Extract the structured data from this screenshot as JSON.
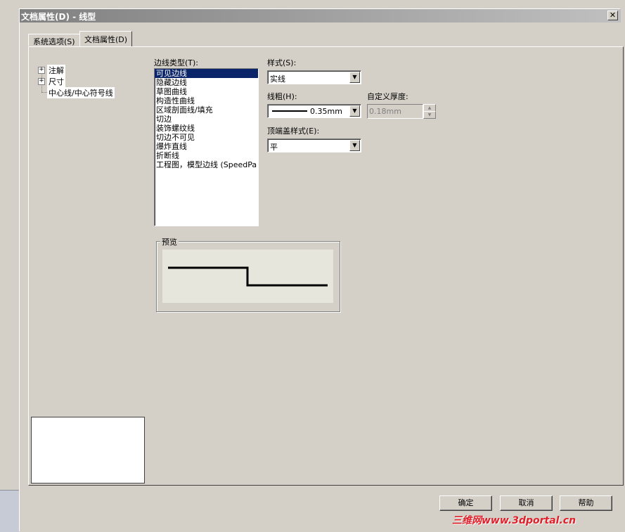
{
  "window": {
    "title": "文档属性(D) - 线型",
    "close_glyph": "✕"
  },
  "tabs": [
    {
      "label": "系统选项(S)",
      "active": false
    },
    {
      "label": "文档属性(D)",
      "active": true
    }
  ],
  "tree": {
    "items": [
      {
        "label": "注解",
        "expandable": true
      },
      {
        "label": "尺寸",
        "expandable": true
      },
      {
        "label": "中心线/中心符号线",
        "expandable": false
      }
    ]
  },
  "edge_type": {
    "label": "边线类型(T):",
    "items": [
      "可见边线",
      "隐藏边线",
      "草图曲线",
      "构造性曲线",
      "区域剖面线/填充",
      "切边",
      "装饰螺纹线",
      "切边不可见",
      "爆炸直线",
      "折断线",
      "工程图，模型边线 (SpeedPa"
    ],
    "selected_index": 0
  },
  "style": {
    "label": "样式(S):",
    "value": "实线"
  },
  "thickness": {
    "label": "线粗(H):",
    "value": "0.35mm"
  },
  "custom_thickness": {
    "label": "自定义厚度:",
    "value": "0.18mm"
  },
  "end_cap": {
    "label": "顶端盖样式(E):",
    "value": "平"
  },
  "preview": {
    "label": "预览"
  },
  "buttons": {
    "ok": "确定",
    "cancel": "取消",
    "help": "帮助"
  },
  "watermark": "三维网www.3dportal.cn",
  "colors": {
    "selection": "#0a246a",
    "dialog_bg": "#d4d0c8",
    "watermark": "#e0202a"
  }
}
